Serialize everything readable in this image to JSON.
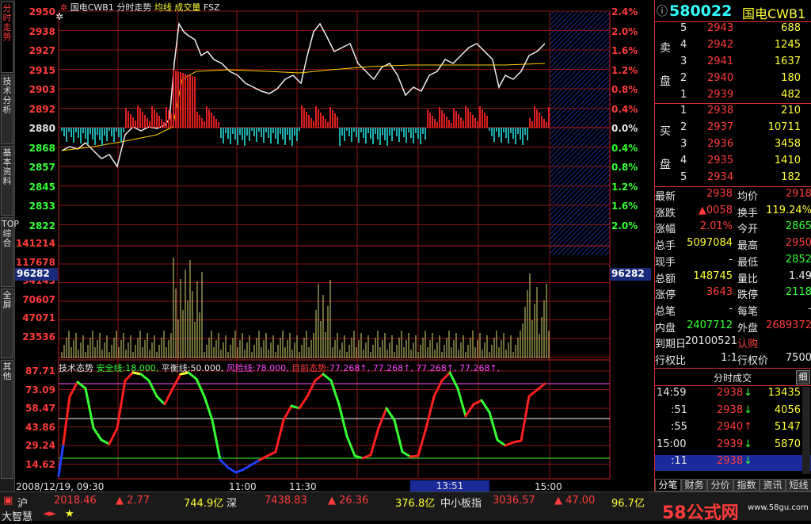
{
  "left_tabs": [
    "分时走势",
    "技术分析",
    "基本资料",
    "TOP综合",
    "全屏",
    "其他"
  ],
  "header": {
    "name": "国电CWB1",
    "view": "分时走势",
    "avg_label": "均线",
    "vol_label": "成交量",
    "code": "FSZ"
  },
  "price_axis": [
    "2950",
    "2938",
    "2927",
    "2915",
    "2903",
    "2892",
    "2880",
    "2868",
    "2857",
    "2845",
    "2833",
    "2822"
  ],
  "pct_axis": [
    "2.4%",
    "2.0%",
    "1.6%",
    "1.2%",
    "0.8%",
    "0.4%",
    "0.0%",
    "0.4%",
    "0.8%",
    "1.2%",
    "1.6%",
    "2.0%"
  ],
  "vol_axis": [
    "141214",
    "117678",
    "94143",
    "70607",
    "47071",
    "23536"
  ],
  "vol_current": "96282",
  "tech_header": {
    "name": "技术态势",
    "safe_label": "安全线:",
    "safe_val": "18.000,",
    "bal_label": "平衡线:",
    "bal_val": "50.000,",
    "risk_label": "风险线:",
    "risk_val": "78.000,",
    "cur_label": "目前态势:",
    "cur_vals": "77.268↑, 77.268↑, 77.268↑, 77.268↑,"
  },
  "tech_axis": [
    "87.71",
    "73.09",
    "58.47",
    "43.86",
    "29.24",
    "14.62"
  ],
  "time_axis": {
    "date": "2008/12/19, 09:30",
    "t1": "11:00",
    "t2": "11:30",
    "cursor": "13:51",
    "t3": "15:00"
  },
  "quote": {
    "code": "580022",
    "name": "国电CWB1",
    "sell_label": [
      "卖",
      "盘"
    ],
    "buy_label": [
      "买",
      "盘"
    ],
    "asks": [
      [
        "5",
        "2943",
        "688"
      ],
      [
        "4",
        "2942",
        "1245"
      ],
      [
        "3",
        "2941",
        "1637"
      ],
      [
        "2",
        "2940",
        "180"
      ],
      [
        "1",
        "2939",
        "482"
      ]
    ],
    "bids": [
      [
        "1",
        "2938",
        "210"
      ],
      [
        "2",
        "2937",
        "10711"
      ],
      [
        "3",
        "2936",
        "3458"
      ],
      [
        "4",
        "2935",
        "1410"
      ],
      [
        "5",
        "2934",
        "182"
      ]
    ],
    "stats": [
      [
        "最新",
        "2938",
        "均价",
        "2918"
      ],
      [
        "涨跌",
        "▲0058",
        "换手",
        "119.24%"
      ],
      [
        "涨幅",
        "2.01%",
        "今开",
        "2865"
      ],
      [
        "总手",
        "5097084",
        "最高",
        "2950"
      ],
      [
        "现手",
        "-",
        "最低",
        "2852"
      ],
      [
        "总额",
        "148745",
        "量比",
        "1.49"
      ],
      [
        "涨停",
        "3643",
        "跌停",
        "2118"
      ],
      [
        "总笔",
        "-",
        "每笔",
        "-"
      ],
      [
        "内盘",
        "2407712",
        "外盘",
        "2689372"
      ],
      [
        "到期日",
        "20100521",
        "认购",
        ""
      ],
      [
        "行权比",
        "1:1",
        "行权价",
        "7500"
      ]
    ],
    "trades_title": "分时成交",
    "trades_btn": "细",
    "trades": [
      [
        "14:59",
        "2938",
        "↓",
        "13435"
      ],
      [
        ":51",
        "2938",
        "↓",
        "4056"
      ],
      [
        ":55",
        "2940",
        "↑",
        "5147"
      ],
      [
        "15:00",
        "2939",
        "↓",
        "5870"
      ],
      [
        ":11",
        "2938",
        "↓",
        ""
      ]
    ],
    "bottom_tabs": [
      "分笔",
      "财务",
      "分价",
      "指数",
      "资讯",
      "短线"
    ]
  },
  "status": {
    "sh_label": "沪",
    "sh_index": "2018.46",
    "sh_chg": "▲ 2.77",
    "sh_amt": "744.9亿",
    "sz_label": "深",
    "sz_index": "7438.83",
    "sz_chg": "▲ 26.36",
    "sz_amt": "376.8亿",
    "zx_label": "中小板指",
    "zx_index": "3036.57",
    "zx_chg": "▲ 47.00",
    "zx_amt": "96.7亿",
    "app": "大智慧",
    "watermark": "58公式网",
    "watermark_url": "www.58gu.com"
  }
}
